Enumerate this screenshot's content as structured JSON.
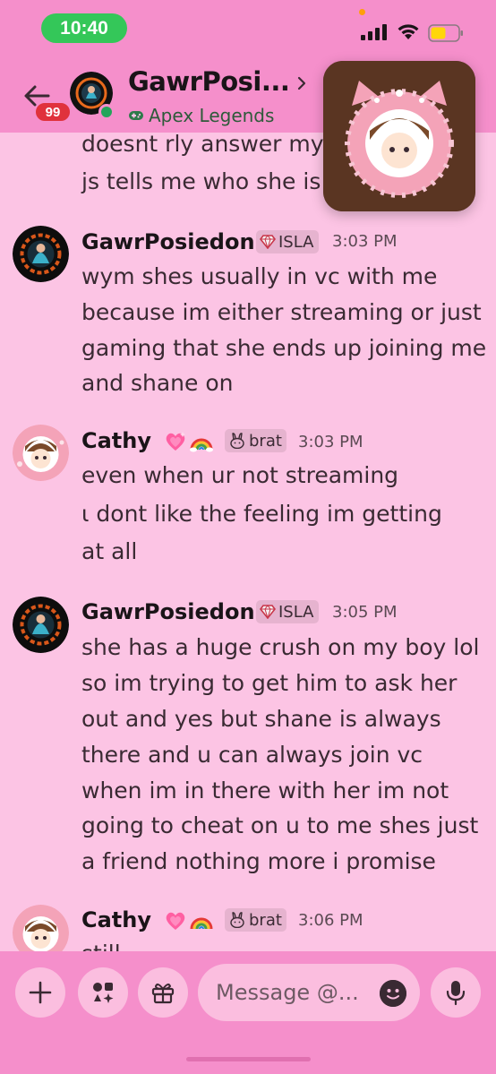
{
  "status_bar": {
    "time": "10:40"
  },
  "header": {
    "unread_count": "99",
    "channel_name": "GawrPosi...",
    "activity": "Apex Legends"
  },
  "messages": [
    {
      "type": "continuation",
      "lines": [
        "doesnt rly answer my",
        "js tells me who she is"
      ]
    },
    {
      "author": "GawrPosiedon",
      "tag": "ISLA",
      "time": "3:03 PM",
      "lines": [
        "wym shes usually in vc with me",
        "because im either streaming or just",
        "gaming that she ends up joining me",
        "and shane on"
      ]
    },
    {
      "author": "Cathy",
      "tag": "brat",
      "time": "3:03 PM",
      "lines": [
        "even when ur not streaming",
        "ι dont like the feeling im getting",
        "at all"
      ]
    },
    {
      "author": "GawrPosiedon",
      "tag": "ISLA",
      "time": "3:05 PM",
      "lines": [
        "she has a huge crush on my boy lol",
        "so im trying to get him to ask her",
        "out and yes but shane is always",
        "there and u can always join vc",
        "when im in there with her im not",
        "going to cheat on u to me shes just",
        "a friend nothing more i promise"
      ]
    },
    {
      "author": "Cathy",
      "tag": "brat",
      "time": "3:06 PM",
      "lines": [
        "still"
      ]
    }
  ],
  "composer": {
    "placeholder": "Message @..."
  },
  "colors": {
    "background": "#fcc4e4",
    "header": "#f58fcb",
    "badge": "#e0323c",
    "online": "#23a55a",
    "time_pill": "#34c759"
  },
  "icons": [
    "back-arrow-icon",
    "chevron-right-icon",
    "gamepad-icon",
    "gem-icon",
    "rabbit-icon",
    "plus-icon",
    "apps-icon",
    "gift-icon",
    "emoji-icon",
    "microphone-icon"
  ]
}
